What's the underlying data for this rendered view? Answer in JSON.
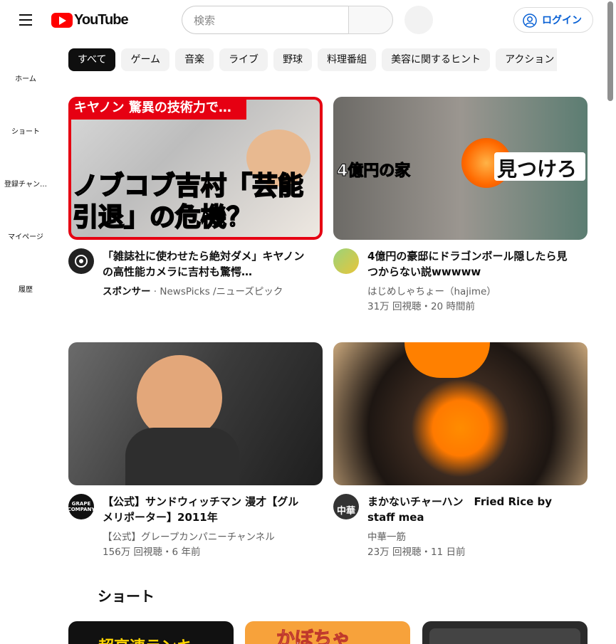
{
  "header": {
    "logo_text": "YouTube",
    "search_placeholder": "検索",
    "login_label": "ログイン"
  },
  "sidebar": {
    "items": [
      {
        "label": "ホーム"
      },
      {
        "label": "ショート"
      },
      {
        "label": "登録チャン…"
      },
      {
        "label": "マイページ"
      },
      {
        "label": "履歴"
      }
    ]
  },
  "chips": [
    "すべて",
    "ゲーム",
    "音楽",
    "ライブ",
    "野球",
    "料理番組",
    "美容に関するヒント",
    "アクション"
  ],
  "videos": [
    {
      "thumb_headline": "キヤノン 驚異の技術力で…",
      "thumb_big": "ノブコブ吉村「芸能引退」の危機？",
      "title": "「雑誌社に使わせたら絶対ダメ」キヤノンの高性能カメラに吉村も驚愕…",
      "sponsor_label": "スポンサー",
      "channel": "NewsPicks /ニューズピック",
      "stats": ""
    },
    {
      "thumb_left": "4億円の家",
      "thumb_right": "見つけろ",
      "title": "4億円の豪邸にドラゴンボール隠したら見つからない説wwwww",
      "channel": "はじめしゃちょー（hajime）",
      "stats": "31万 回視聴・20 時間前"
    },
    {
      "title": "【公式】サンドウィッチマン 漫才【グルメリポーター】2011年",
      "channel": "【公式】グレープカンパニーチャンネル",
      "stats": "156万 回視聴・6 年前",
      "avatar_text": "GRAPE COMPANY"
    },
    {
      "title": "まかないチャーハン　Fried Rice by staff mea",
      "channel": "中華一筋",
      "stats": "23万 回視聴・11 日前",
      "avatar_text": "中華"
    }
  ],
  "shorts": {
    "section_title": "ショート",
    "items": [
      {
        "text": "超高速ランキ"
      },
      {
        "text": "かぼちゃ"
      },
      {
        "text": ""
      }
    ]
  }
}
